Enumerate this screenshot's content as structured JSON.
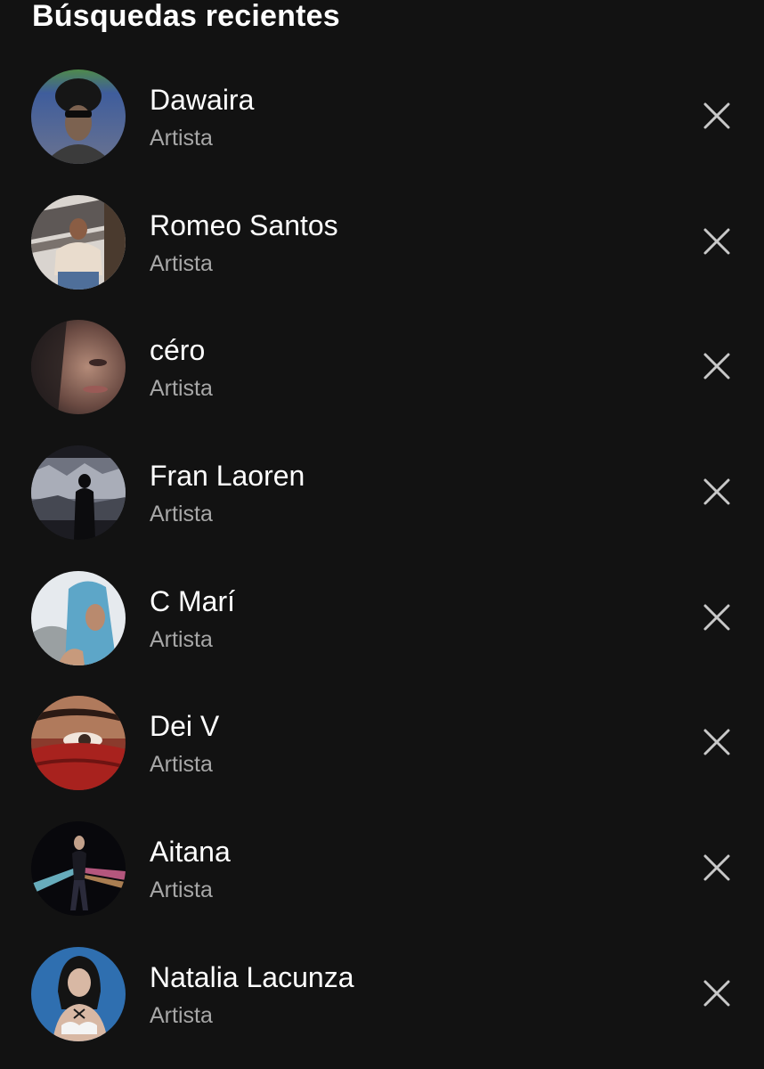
{
  "header": {
    "title": "Búsquedas recientes"
  },
  "recent_searches": [
    {
      "name": "Dawaira",
      "type": "Artista",
      "avatar_icon": "artist-photo"
    },
    {
      "name": "Romeo Santos",
      "type": "Artista",
      "avatar_icon": "artist-photo"
    },
    {
      "name": "céro",
      "type": "Artista",
      "avatar_icon": "artist-photo"
    },
    {
      "name": "Fran Laoren",
      "type": "Artista",
      "avatar_icon": "artist-photo"
    },
    {
      "name": "C Marí",
      "type": "Artista",
      "avatar_icon": "artist-photo"
    },
    {
      "name": "Dei V",
      "type": "Artista",
      "avatar_icon": "artist-photo"
    },
    {
      "name": "Aitana",
      "type": "Artista",
      "avatar_icon": "artist-photo"
    },
    {
      "name": "Natalia Lacunza",
      "type": "Artista",
      "avatar_icon": "artist-photo"
    }
  ],
  "icons": {
    "remove": "close-icon"
  },
  "colors": {
    "background": "#121212",
    "primary_text": "#ffffff",
    "secondary_text": "#a7a7a7",
    "icon": "#c8c8c8"
  }
}
